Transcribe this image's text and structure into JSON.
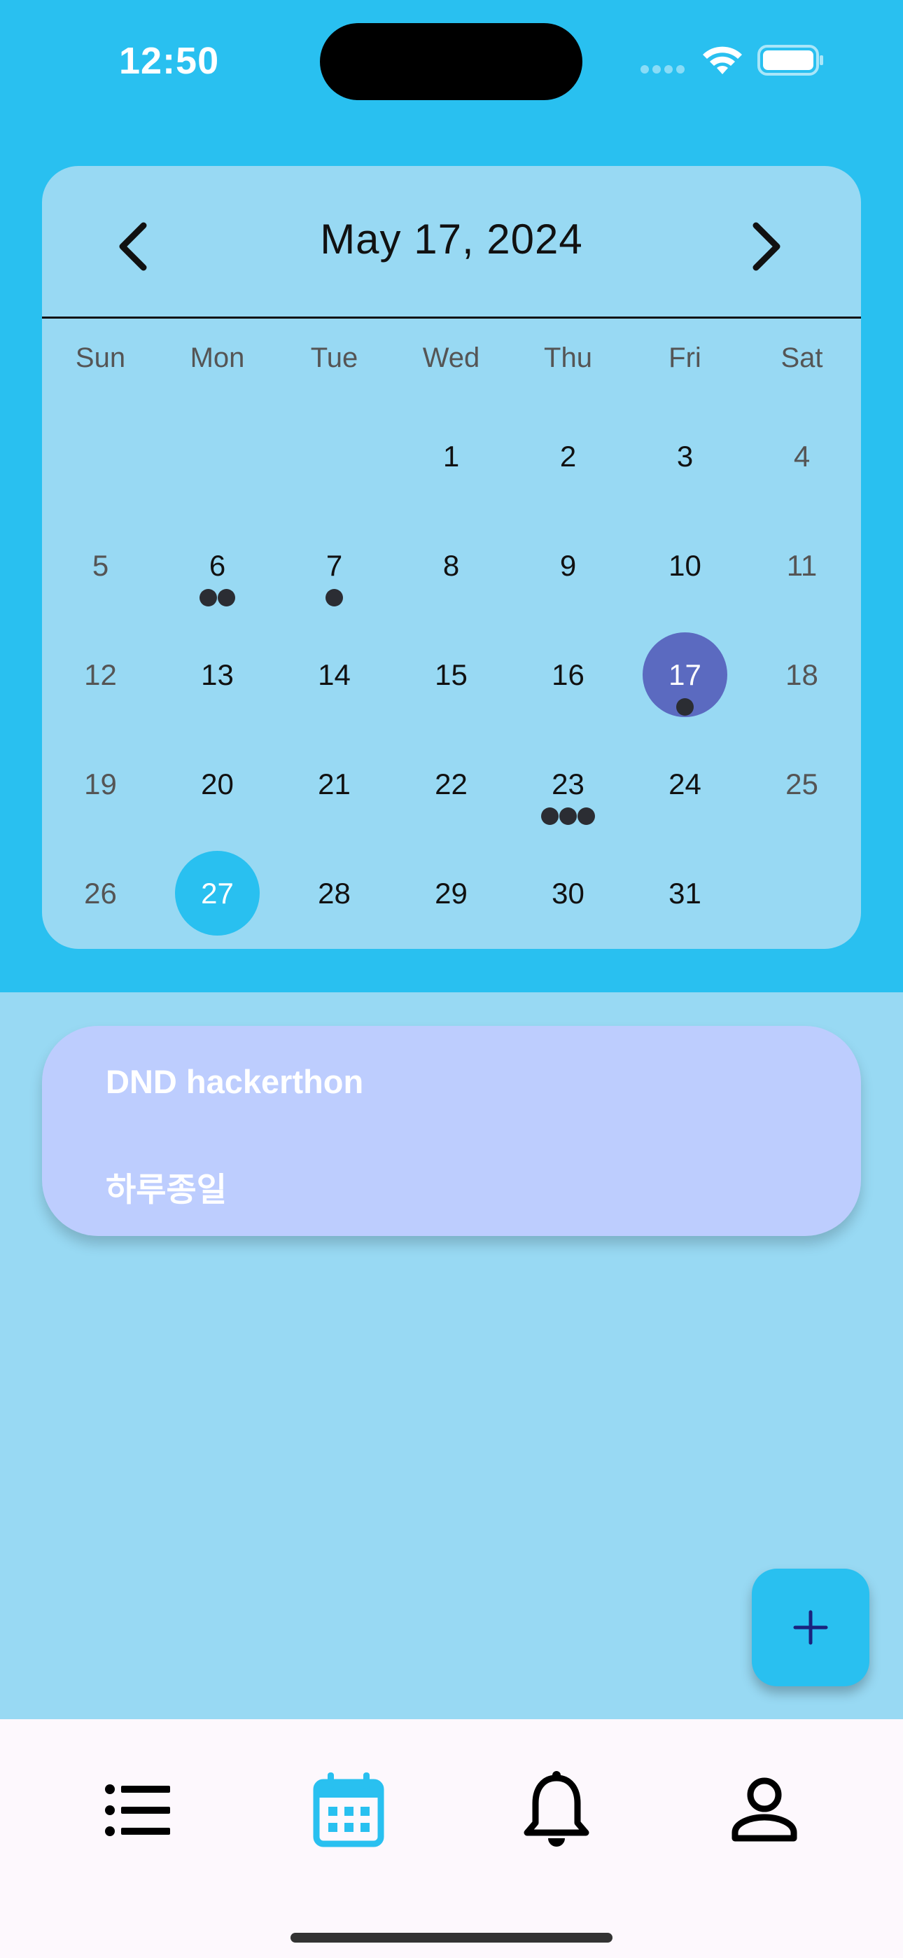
{
  "status_bar": {
    "time": "12:50"
  },
  "calendar": {
    "title": "May 17, 2024",
    "weekdays": [
      "Sun",
      "Mon",
      "Tue",
      "Wed",
      "Thu",
      "Fri",
      "Sat"
    ],
    "first_weekday_index": 3,
    "days_in_month": 31,
    "selected_day": 17,
    "today_day": 27,
    "markers": {
      "6": 2,
      "7": 1,
      "17": 1,
      "23": 3
    }
  },
  "event": {
    "title": "DND hackerthon",
    "subtitle": "하루종일"
  },
  "fab": {
    "icon": "plus-icon"
  },
  "bottom_nav": {
    "items": [
      {
        "icon": "list-icon",
        "active": false
      },
      {
        "icon": "calendar-icon",
        "active": true
      },
      {
        "icon": "bell-icon",
        "active": false
      },
      {
        "icon": "person-icon",
        "active": false
      }
    ]
  },
  "colors": {
    "primary": "#29c0f0",
    "selected": "#5b6ac0",
    "event_card": "#bdcdfe",
    "background": "#98d9f3"
  }
}
